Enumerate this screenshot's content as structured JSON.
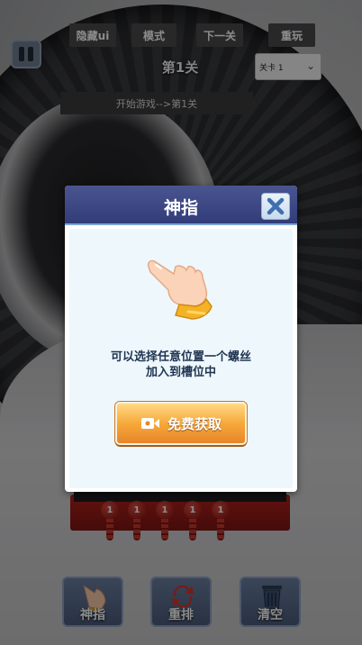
{
  "hud": {
    "hide_ui": "隐藏ui",
    "mode": "模式",
    "next_level": "下一关",
    "restart": "重玩",
    "level_title": "第1关",
    "level_select_value": "关卡 1",
    "level_path": "开始游戏-->第1关"
  },
  "modal": {
    "title": "神指",
    "description_line1": "可以选择任意位置一个螺丝",
    "description_line2": "加入到槽位中",
    "free_button_label": "免费获取",
    "icons": [
      "close-icon",
      "finger-hand-icon",
      "video-icon"
    ]
  },
  "screws": [
    {
      "number": "1"
    },
    {
      "number": "1"
    },
    {
      "number": "1"
    },
    {
      "number": "1"
    },
    {
      "number": "1"
    }
  ],
  "tools": {
    "finger": "神指",
    "shuffle": "重排",
    "clear": "清空"
  },
  "colors": {
    "modal_header": "#3a4582",
    "modal_body": "#eef7fc",
    "button_orange": "#f6a93a",
    "screw_red": "#b3221c"
  }
}
